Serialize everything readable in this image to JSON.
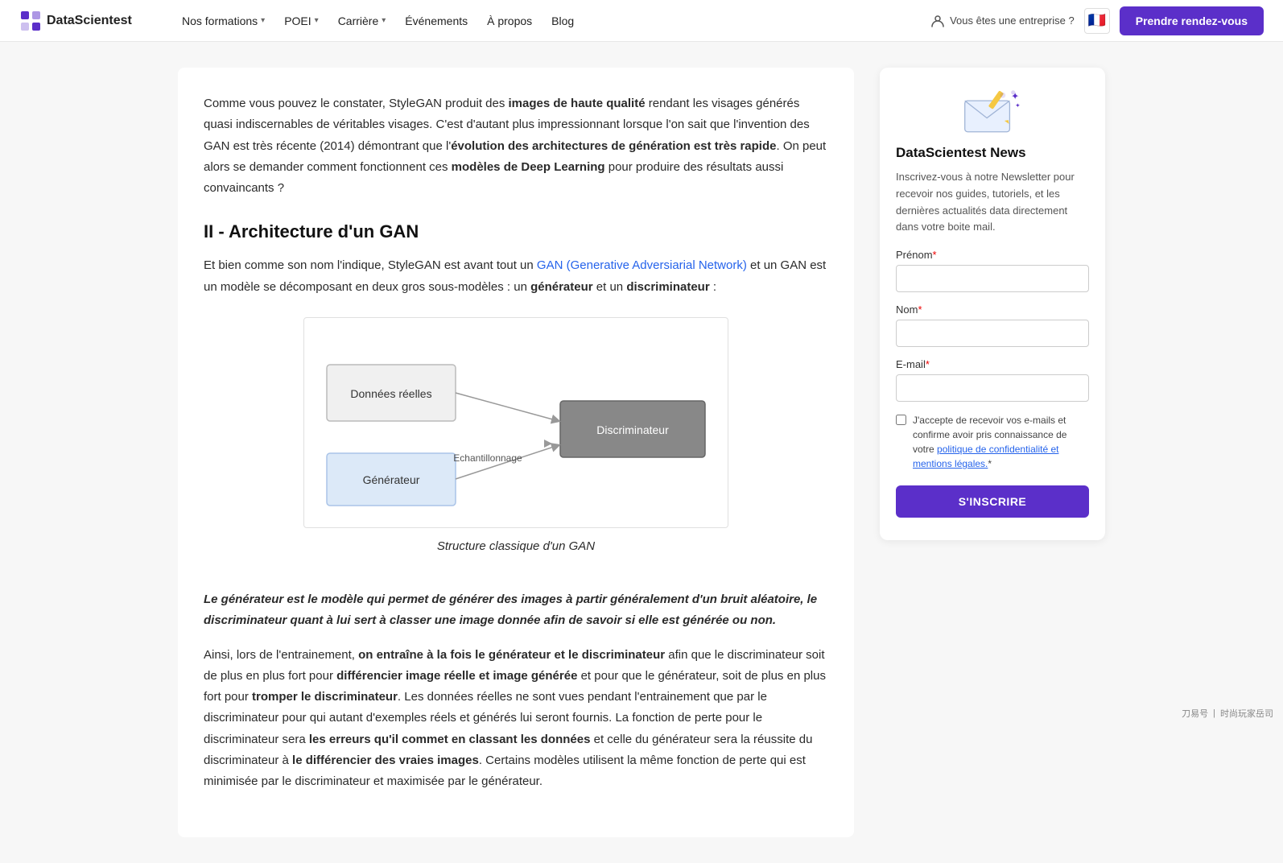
{
  "navbar": {
    "logo_text": "DataScientest",
    "nav_items": [
      {
        "label": "Nos formations",
        "has_dropdown": true
      },
      {
        "label": "POEI",
        "has_dropdown": true
      },
      {
        "label": "Carrière",
        "has_dropdown": true
      },
      {
        "label": "Événements",
        "has_dropdown": false
      },
      {
        "label": "À propos",
        "has_dropdown": false
      },
      {
        "label": "Blog",
        "has_dropdown": false
      }
    ],
    "enterprise_label": "Vous êtes une entreprise ?",
    "flag_emoji": "🇫🇷",
    "cta_label": "Prendre rendez-vous"
  },
  "article": {
    "paragraph1_before": "Comme vous pouvez le constater, StyleGAN produit des ",
    "paragraph1_bold1": "images de haute qualité",
    "paragraph1_mid1": " rendant les visages générés quasi indiscernables de véritables visages. C'est d'autant plus impressionnant lorsque l'on sait que l'invention des GAN est très récente (2014) démontrant que l'",
    "paragraph1_bold2": "évolution des architectures de génération est très rapide",
    "paragraph1_end": ". On peut alors se demander comment fonctionnent ces ",
    "paragraph1_bold3": "modèles de Deep Learning",
    "paragraph1_final": " pour produire des résultats aussi convaincants ?",
    "section_title": "II - Architecture d'un GAN",
    "paragraph2_before": "Et bien comme son nom l'indique, StyleGAN est avant tout un ",
    "paragraph2_link": "GAN (Generative Adversiarial Network)",
    "paragraph2_after": " et un GAN est un modèle se décomposant en deux gros sous-modèles : un ",
    "paragraph2_bold1": "générateur",
    "paragraph2_mid": " et un ",
    "paragraph2_bold2": "discriminateur",
    "paragraph2_end": " :",
    "diagram_caption": "Structure classique d'un GAN",
    "diagram_labels": {
      "real_data": "Données réelles",
      "generator": "Générateur",
      "sampling": "Echantillonnage",
      "discriminator": "Discriminateur"
    },
    "italic_text": "Le générateur est le modèle qui permet de générer des images à partir généralement d'un bruit aléatoire, le discriminateur quant à lui sert à classer une image donnée afin de savoir si elle est générée ou non.",
    "paragraph3_before": "Ainsi, lors de l'entrainement, ",
    "paragraph3_bold1": "on entraîne à la fois le générateur et le discriminateur",
    "paragraph3_mid1": " afin que le discriminateur soit de plus en plus fort pour ",
    "paragraph3_bold2": "différencier image réelle et image générée",
    "paragraph3_mid2": " et pour que le générateur, soit de plus en plus fort pour ",
    "paragraph3_bold3": "tromper le discriminateur",
    "paragraph3_mid3": ". Les données réelles ne sont vues pendant l'entrainement que par le discriminateur pour qui autant d'exemples réels et générés lui seront fournis. La fonction de perte pour le discriminateur sera ",
    "paragraph3_bold4": "les erreurs qu'il commet en classant les données",
    "paragraph3_mid4": " et celle du générateur sera la réussite du discriminateur à ",
    "paragraph3_bold5": "le différencier des vraies images",
    "paragraph3_end": ". Certains modèles utilisent la même fonction de perte qui est minimisée par le discriminateur et maximisée par le générateur."
  },
  "sidebar": {
    "newsletter_title": "DataScientest News",
    "newsletter_desc": "Inscrivez-vous à notre Newsletter pour recevoir nos guides, tutoriels, et les dernières actualités data directement dans votre boite mail.",
    "prenom_label": "Prénom",
    "prenom_required": true,
    "nom_label": "Nom",
    "nom_required": true,
    "email_label": "E-mail",
    "email_required": true,
    "checkbox_text": "J'accepte de recevoir vos e-mails et confirme avoir pris connaissance de votre politique de confidentialité et mentions légales.",
    "submit_label": "S'INSCRIRE"
  },
  "watermark": {
    "text1": "刀易号",
    "separator": "|",
    "text2": "时尚玩家岳司"
  }
}
